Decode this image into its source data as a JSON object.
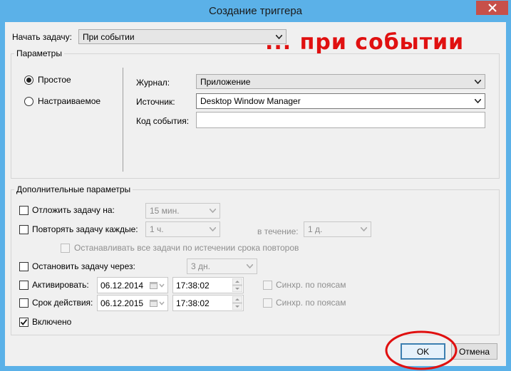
{
  "window": {
    "title": "Создание триггера"
  },
  "start_task": {
    "label": "Начать задачу:",
    "value": "При событии"
  },
  "annotation": {
    "text": "... при событии",
    "color": "#e01010"
  },
  "params": {
    "legend": "Параметры",
    "simple_label": "Простое",
    "custom_label": "Настраиваемое",
    "selected": "Простое",
    "log_label": "Журнал:",
    "log_value": "Приложение",
    "source_label": "Источник:",
    "source_value": "Desktop Window Manager",
    "event_id_label": "Код события:",
    "event_id_value": ""
  },
  "advanced": {
    "legend": "Дополнительные параметры",
    "delay": {
      "label": "Отложить задачу на:",
      "value": "15 мин.",
      "checked": false
    },
    "repeat": {
      "label": "Повторять задачу каждые:",
      "value": "1 ч.",
      "duration_label": "в течение:",
      "duration_value": "1 д.",
      "checked": false
    },
    "stop_all": {
      "label": "Останавливать все задачи по истечении срока повторов",
      "checked": false
    },
    "stop_after": {
      "label": "Остановить задачу через:",
      "value": "3 дн.",
      "checked": false
    },
    "activate": {
      "label": "Активировать:",
      "date": "06.12.2014",
      "time": "17:38:02",
      "sync_label": "Синхр. по поясам",
      "checked": false
    },
    "expire": {
      "label": "Срок действия:",
      "date": "06.12.2015",
      "time": "17:38:02",
      "sync_label": "Синхр. по поясам",
      "checked": false
    },
    "enabled": {
      "label": "Включено",
      "checked": true
    }
  },
  "buttons": {
    "ok": "OK",
    "cancel": "Отмена"
  },
  "icons": {
    "close": "close-icon",
    "dropdown": "chevron-down-icon",
    "calendar": "calendar-icon",
    "spin": "spin-updown-icon",
    "check": "check-icon"
  }
}
